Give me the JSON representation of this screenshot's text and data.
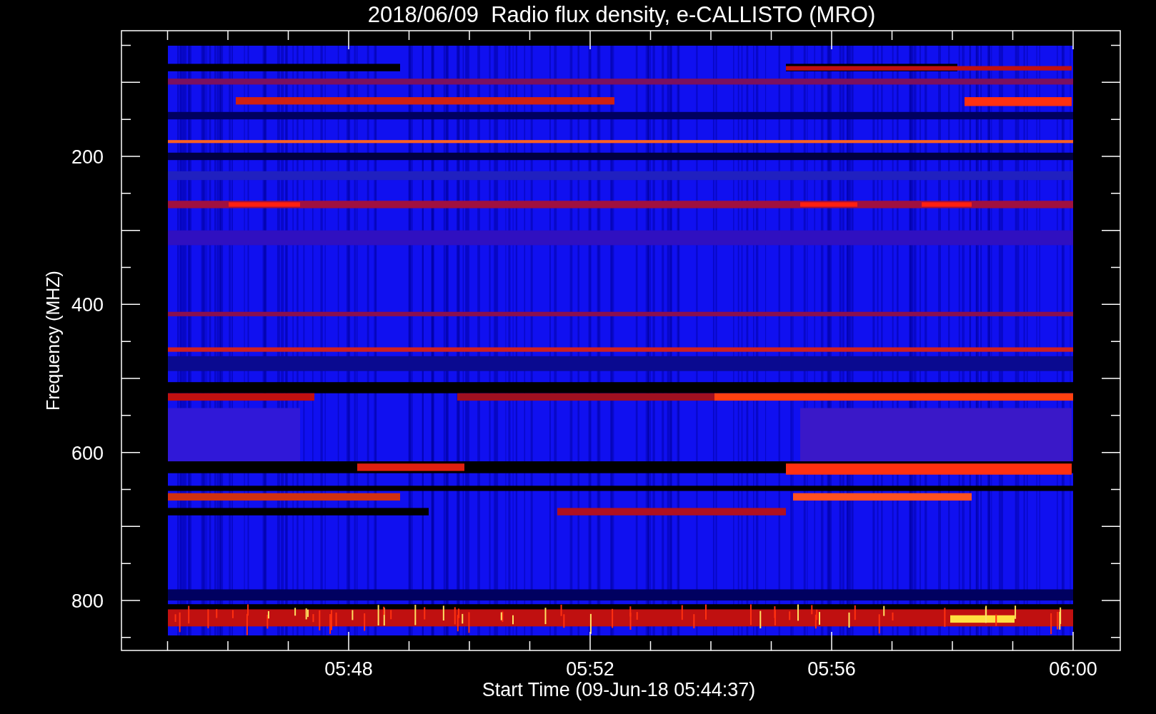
{
  "title": "2018/06/09  Radio flux density, e-CALLISTO (MRO)",
  "plot": {
    "xlabel": "Start Time (09-Jun-18 05:44:37)",
    "ylabel": "Frequency (MHZ)",
    "xtick_labels": [
      "05:48",
      "05:52",
      "05:56",
      "06:00"
    ],
    "ytick_labels": [
      "200",
      "400",
      "600",
      "800"
    ]
  }
}
